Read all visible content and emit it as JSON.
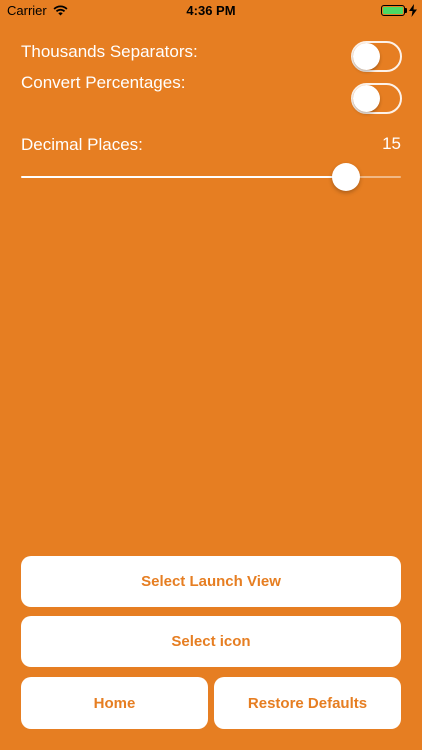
{
  "status_bar": {
    "carrier": "Carrier",
    "time": "4:36 PM",
    "battery_color": "#4CD964"
  },
  "settings": {
    "thousands_separators": {
      "label": "Thousands Separators:",
      "enabled": false
    },
    "convert_percentages": {
      "label": "Convert Percentages:",
      "enabled": false
    },
    "decimal_places": {
      "label": "Decimal Places:",
      "value": "15",
      "slider_min": 0,
      "slider_max": 17,
      "slider_value": 15
    }
  },
  "buttons": {
    "select_launch_view": "Select Launch View",
    "select_icon": "Select icon",
    "home": "Home",
    "restore_defaults": "Restore Defaults"
  },
  "colors": {
    "background": "#E67E22",
    "button_background": "#FFFFFF",
    "button_text": "#E67E22"
  }
}
